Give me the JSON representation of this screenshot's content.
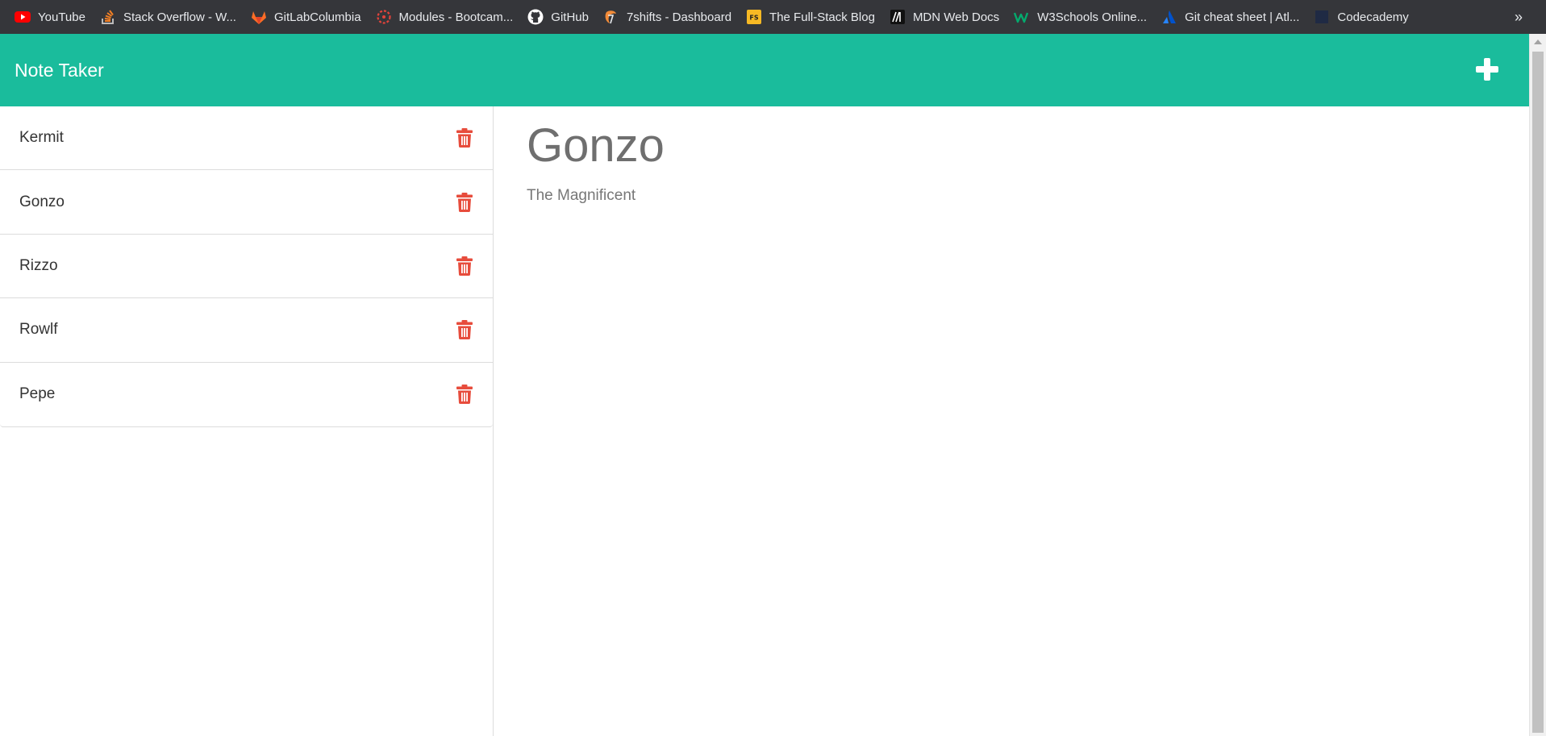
{
  "bookmarks": [
    {
      "label": "YouTube",
      "icon": "youtube-icon"
    },
    {
      "label": "Stack Overflow - W...",
      "icon": "stackoverflow-icon"
    },
    {
      "label": "GitLabColumbia",
      "icon": "gitlab-icon"
    },
    {
      "label": "Modules - Bootcam...",
      "icon": "bootcamp-icon"
    },
    {
      "label": "GitHub",
      "icon": "github-icon"
    },
    {
      "label": "7shifts - Dashboard",
      "icon": "7shifts-icon"
    },
    {
      "label": "The Full-Stack Blog",
      "icon": "fullstack-blog-icon"
    },
    {
      "label": "MDN Web Docs",
      "icon": "mdn-icon"
    },
    {
      "label": "W3Schools Online...",
      "icon": "w3schools-icon"
    },
    {
      "label": "Git cheat sheet | Atl...",
      "icon": "atlassian-icon"
    },
    {
      "label": "Codecademy",
      "icon": "codecademy-icon"
    }
  ],
  "bookmarks_overflow": "»",
  "header": {
    "brand": "Note Taker",
    "new_note_icon": "plus-icon"
  },
  "notes": [
    {
      "title": "Kermit"
    },
    {
      "title": "Gonzo"
    },
    {
      "title": "Rizzo"
    },
    {
      "title": "Rowlf"
    },
    {
      "title": "Pepe"
    }
  ],
  "active_note": {
    "title": "Gonzo",
    "text": "The Magnificent"
  },
  "colors": {
    "header": "#1abc9c",
    "delete": "#e74c3c",
    "bookmarks_bar": "#35363a"
  }
}
